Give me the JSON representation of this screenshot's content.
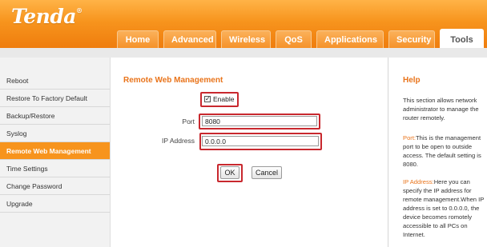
{
  "brand": {
    "name": "Tenda",
    "mark": "®"
  },
  "nav": {
    "tabs": [
      {
        "label": "Home"
      },
      {
        "label": "Advanced"
      },
      {
        "label": "Wireless"
      },
      {
        "label": "QoS"
      },
      {
        "label": "Applications"
      },
      {
        "label": "Security"
      },
      {
        "label": "Tools"
      }
    ],
    "active": "Tools"
  },
  "sidebar": {
    "items": [
      {
        "label": "Reboot"
      },
      {
        "label": "Restore To Factory Default"
      },
      {
        "label": "Backup/Restore"
      },
      {
        "label": "Syslog"
      },
      {
        "label": "Remote Web Management"
      },
      {
        "label": "Time Settings"
      },
      {
        "label": "Change Password"
      },
      {
        "label": "Upgrade"
      }
    ],
    "active": "Remote Web Management"
  },
  "main": {
    "title": "Remote Web Management",
    "enable": {
      "label": "Enable",
      "checked": true
    },
    "port": {
      "label": "Port",
      "value": "8080"
    },
    "ip": {
      "label": "IP Address",
      "value": "0.0.0.0"
    },
    "ok_label": "OK",
    "cancel_label": "Cancel"
  },
  "help": {
    "title": "Help",
    "intro": "This section allows network administrator to manage the router remotely.",
    "port_term": "Port:",
    "port_text": "This is the management port to be open to outside access. The default setting is 8080.",
    "ip_term": "IP Address:",
    "ip_text": "Here you can specify the IP address for remote management.When IP address is set to 0.0.0.0, the device becomes romotely accessible to all PCs on Internet."
  },
  "colors": {
    "accent": "#f7941d",
    "title_orange": "#e9741b",
    "highlight_red": "#c8282e"
  }
}
